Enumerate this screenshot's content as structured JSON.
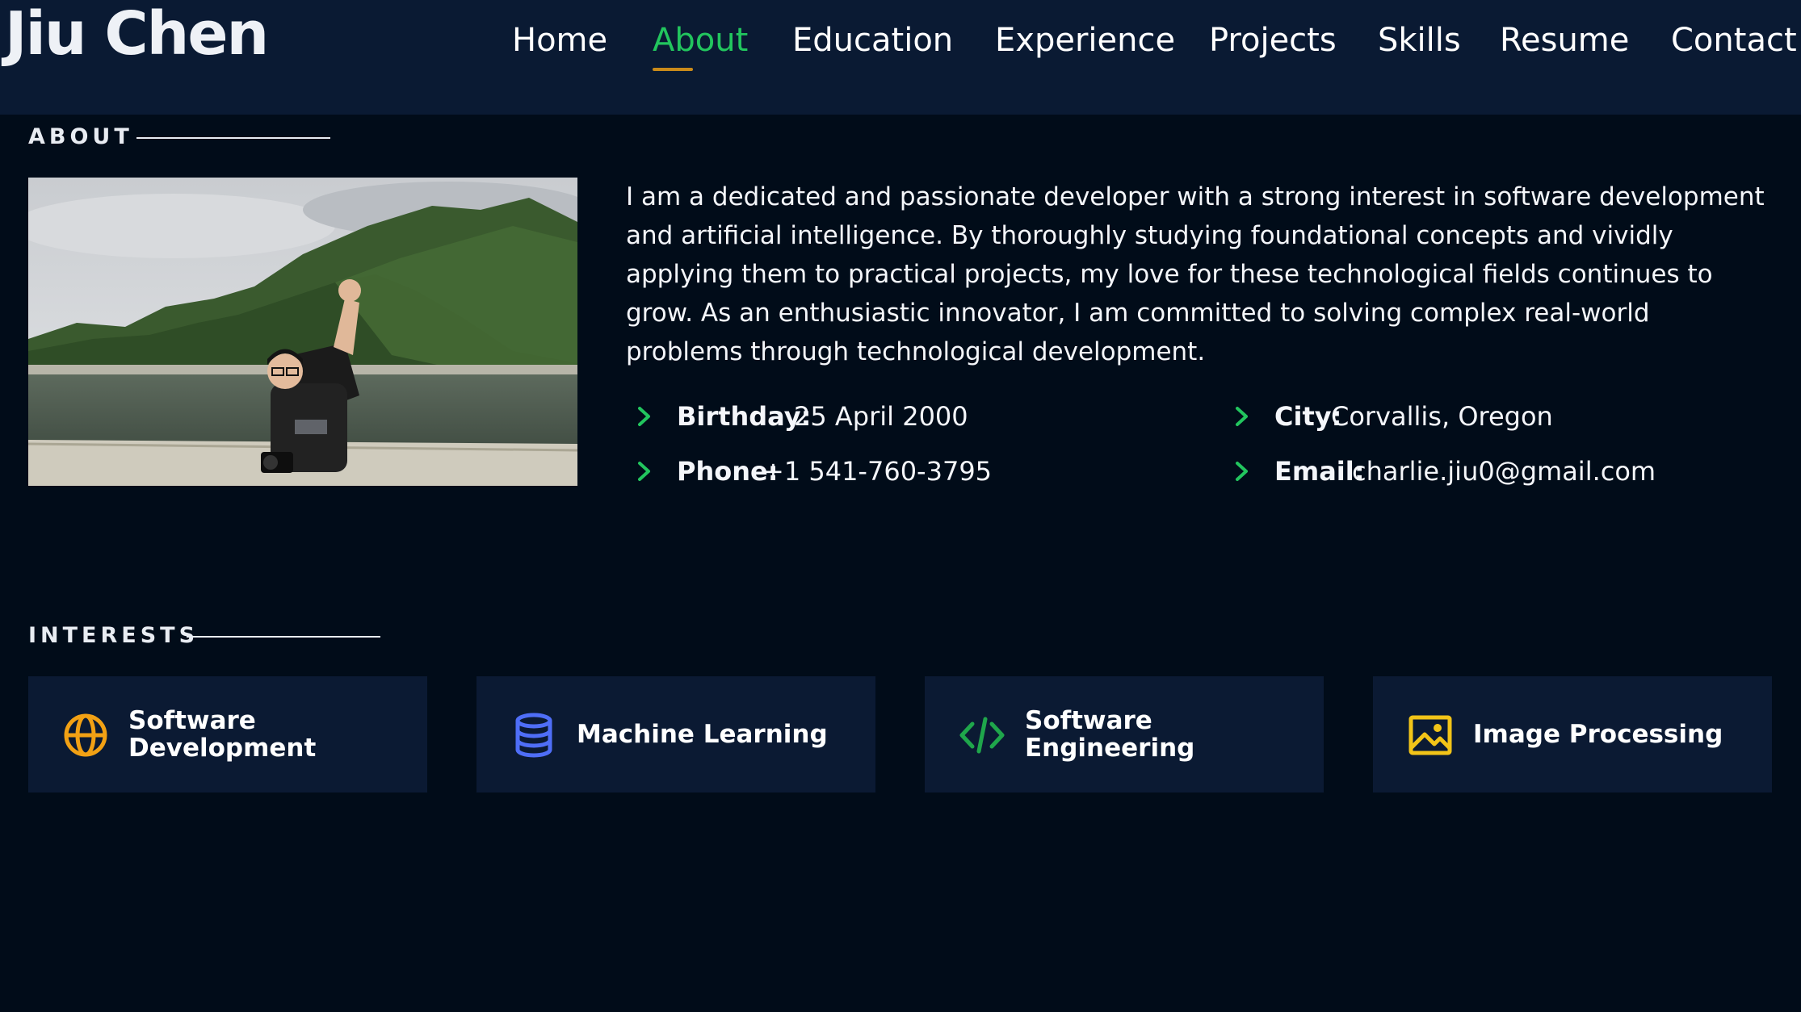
{
  "header": {
    "logo": "Jiu Chen",
    "nav": [
      {
        "label": "Home",
        "active": false
      },
      {
        "label": "About",
        "active": true
      },
      {
        "label": "Education",
        "active": false
      },
      {
        "label": "Experience",
        "active": false
      },
      {
        "label": "Projects",
        "active": false
      },
      {
        "label": "Skills",
        "active": false
      },
      {
        "label": "Resume",
        "active": false
      },
      {
        "label": "Contact",
        "active": false
      }
    ]
  },
  "about": {
    "title": "ABOUT",
    "bio": "I am a dedicated and passionate developer with a strong interest in software development and artificial intelligence. By thoroughly studying foundational concepts and vividly applying them to practical projects, my love for these technological fields continues to grow. As an enthusiastic innovator, I am committed to solving complex real-world problems through technological development.",
    "info": {
      "birthday": {
        "label": "Birthday:",
        "value": "25 April 2000"
      },
      "city": {
        "label": "City:",
        "value": "Corvallis, Oregon"
      },
      "phone": {
        "label": "Phone:",
        "value": "+1 541-760-3795"
      },
      "email": {
        "label": "Email:",
        "value": "charlie.jiu0@gmail.com"
      }
    }
  },
  "interests": {
    "title": "INTERESTS",
    "items": [
      {
        "line1": "Software",
        "line2": "Development",
        "icon": "globe-icon",
        "color": "#f2a114"
      },
      {
        "line1": "Machine Learning",
        "line2": "",
        "icon": "database-icon",
        "color": "#4f6ef7"
      },
      {
        "line1": "Software",
        "line2": "Engineering",
        "icon": "code-icon",
        "color": "#1fa64b"
      },
      {
        "line1": "Image Processing",
        "line2": "",
        "icon": "image-icon",
        "color": "#f2c418"
      }
    ]
  },
  "colors": {
    "accent": "#22c55e",
    "nav_underline": "#c98a1a",
    "header_bg": "#0a1a33",
    "page_bg": "#010c19",
    "card_bg": "#0b1a33"
  }
}
